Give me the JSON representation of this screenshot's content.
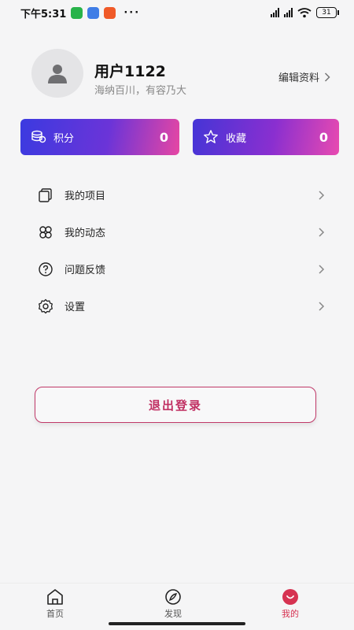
{
  "status_bar": {
    "time": "下午5:31",
    "more": "···",
    "battery": "31"
  },
  "profile": {
    "username": "用户1122",
    "motto": "海纳百川，有容乃大",
    "edit_label": "编辑资料"
  },
  "cards": [
    {
      "label": "积分",
      "value": "0",
      "icon": "coins-icon"
    },
    {
      "label": "收藏",
      "value": "0",
      "icon": "star-icon"
    }
  ],
  "menu": {
    "items": [
      {
        "label": "我的项目",
        "icon": "folder-icon"
      },
      {
        "label": "我的动态",
        "icon": "clover-icon"
      },
      {
        "label": "问题反馈",
        "icon": "question-icon"
      },
      {
        "label": "设置",
        "icon": "gear-icon"
      }
    ]
  },
  "logout_label": "退出登录",
  "bottom_nav": {
    "items": [
      {
        "label": "首页",
        "icon": "home-icon"
      },
      {
        "label": "发现",
        "icon": "compass-icon"
      },
      {
        "label": "我的",
        "icon": "profile-icon"
      }
    ],
    "active_color": "#d63251"
  },
  "colors": {
    "accent": "#c02f62",
    "card_gradient_start": "#3b3ae0",
    "card_gradient_end": "#e646a3"
  }
}
